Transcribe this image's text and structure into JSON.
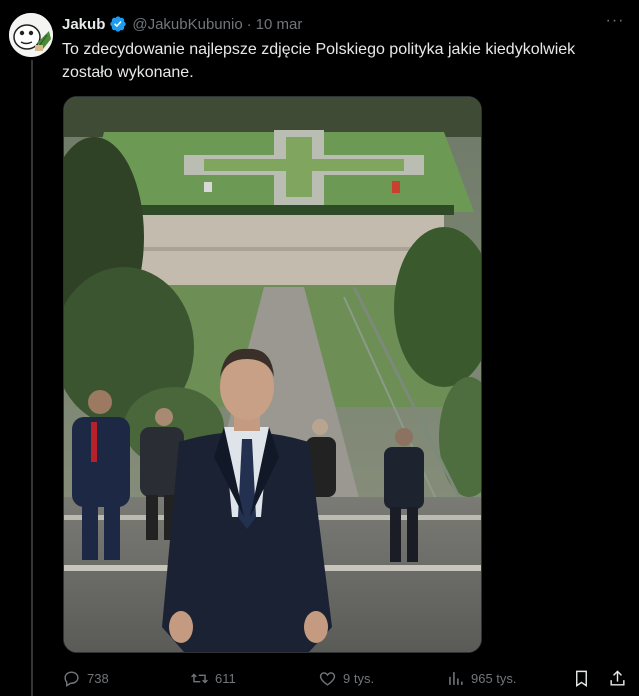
{
  "tweet": {
    "author_name": "Jakub",
    "handle": "@JakubKubunio",
    "separator": "·",
    "date": "10 mar",
    "text": "To zdecydowanie najlepsze zdjęcie Polskiego polityka jakie kiedykolwiek zostało wykonane.",
    "more_label": "···"
  },
  "actions": {
    "replies": "738",
    "reposts": "611",
    "likes": "9 tys.",
    "views": "965 tys."
  },
  "colors": {
    "background": "#000000",
    "text": "#e7e9ea",
    "secondary": "#71767b",
    "verified": "#1d9bf0"
  },
  "icons": [
    "verified-badge-icon",
    "more-icon",
    "reply-icon",
    "repost-icon",
    "like-icon",
    "views-icon",
    "bookmark-icon",
    "share-icon"
  ]
}
